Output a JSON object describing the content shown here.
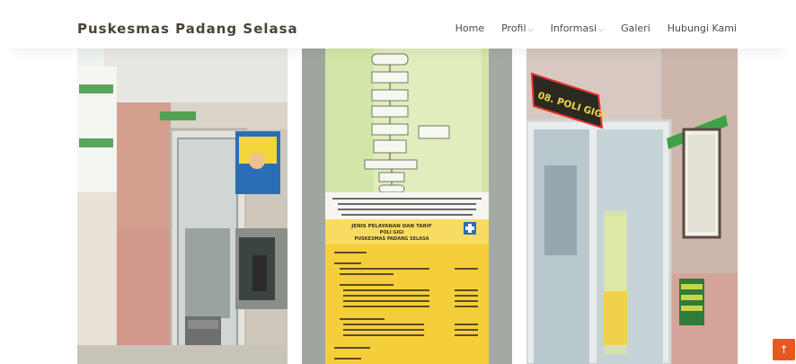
{
  "brand": "Puskesmas Padang Selasa",
  "nav": {
    "home": "Home",
    "profil": "Profil",
    "informasi": "Informasi",
    "galeri": "Galeri",
    "hubungi": "Hubungi Kami"
  },
  "photo2": {
    "title1": "JENIS PELAYANAN DAN TARIF",
    "title2": "POLI GIGI",
    "title3": "PUSKESMAS PADANG SELASA"
  },
  "photo3": {
    "sign": "08. POLI GIGI"
  },
  "back_to_top": "↑",
  "colors": {
    "accent": "#e8571f",
    "brand": "#4a4335"
  }
}
